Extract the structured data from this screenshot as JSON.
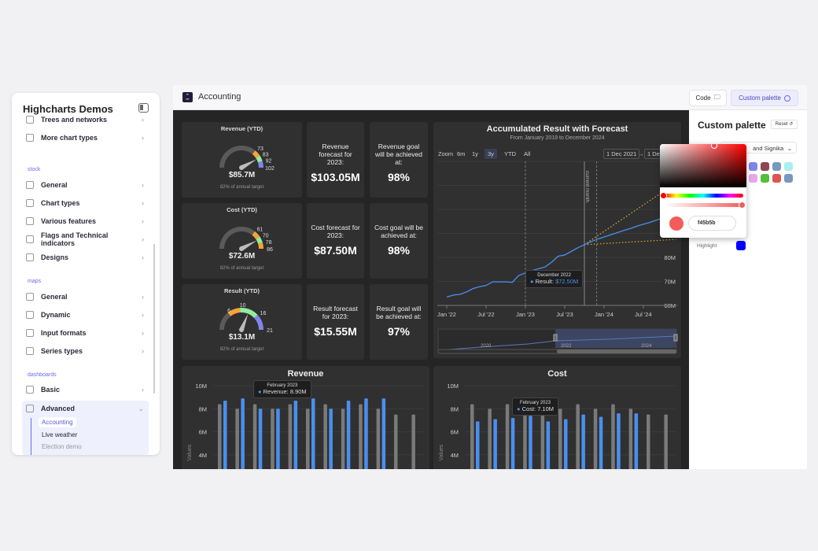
{
  "sidebar": {
    "title": "Highcharts Demos",
    "top_items": [
      {
        "label": "Trees and networks",
        "icon": "line-chart-icon"
      },
      {
        "label": "More chart types",
        "icon": "star-chart-icon"
      }
    ],
    "sections": [
      {
        "label": "stock",
        "items": [
          {
            "label": "General",
            "icon": "stock-general-icon"
          },
          {
            "label": "Chart types",
            "icon": "chart-types-icon"
          },
          {
            "label": "Various features",
            "icon": "features-icon"
          },
          {
            "label": "Flags and Technical indicators",
            "icon": "flag-icon"
          },
          {
            "label": "Designs",
            "icon": "palette-icon"
          }
        ]
      },
      {
        "label": "maps",
        "items": [
          {
            "label": "General",
            "icon": "globe-icon"
          },
          {
            "label": "Dynamic",
            "icon": "dynamic-icon"
          },
          {
            "label": "Input formats",
            "icon": "file-icon"
          },
          {
            "label": "Series types",
            "icon": "series-icon"
          }
        ]
      },
      {
        "label": "dashboards",
        "items": [
          {
            "label": "Basic",
            "icon": "dashboard-icon"
          },
          {
            "label": "Advanced",
            "icon": "dashboard-icon",
            "expanded": true
          }
        ]
      }
    ],
    "sub_items": [
      {
        "label": "Accounting",
        "active": true
      },
      {
        "label": "Live weather"
      },
      {
        "label": "Election demo"
      }
    ]
  },
  "header": {
    "title": "Accounting",
    "code_label": "Code",
    "palette_label": "Custom palette"
  },
  "gauges": [
    {
      "title": "Revenue (YTD)",
      "value_label": "$85.7M",
      "value": 85.7,
      "min": 0,
      "max": 102,
      "sub": "82% of annual target",
      "bands": [
        {
          "from": 0,
          "to": 73,
          "color": "#5a5a5a"
        },
        {
          "from": 73,
          "to": 83,
          "color": "#f7a33a"
        },
        {
          "from": 83,
          "to": 92,
          "color": "#90ed9d"
        },
        {
          "from": 92,
          "to": 102,
          "color": "#8085e9"
        }
      ],
      "ticks": [
        "73",
        "83",
        "92",
        "102"
      ]
    },
    {
      "title": "Cost (YTD)",
      "value_label": "$72.6M",
      "value": 72.6,
      "min": 0,
      "max": 86,
      "sub": "82% of annual target",
      "bands": [
        {
          "from": 0,
          "to": 61,
          "color": "#5a5a5a"
        },
        {
          "from": 61,
          "to": 70,
          "color": "#f7a33a"
        },
        {
          "from": 70,
          "to": 78,
          "color": "#90ed9d"
        },
        {
          "from": 78,
          "to": 86,
          "color": "#f7a33a"
        }
      ],
      "ticks": [
        "61",
        "70",
        "78",
        "86"
      ]
    },
    {
      "title": "Result (YTD)",
      "value_label": "$13.1M",
      "value": 13.1,
      "min": 0,
      "max": 21,
      "sub": "82% of annual target",
      "bands": [
        {
          "from": 0,
          "to": 6,
          "color": "#5a5a5a"
        },
        {
          "from": 6,
          "to": 10,
          "color": "#f7a33a"
        },
        {
          "from": 10,
          "to": 16,
          "color": "#90ed9d"
        },
        {
          "from": 16,
          "to": 21,
          "color": "#8085e9"
        }
      ],
      "ticks": [
        "6",
        "10",
        "16",
        "21"
      ]
    }
  ],
  "forecasts": [
    {
      "label": "Revenue forecast for 2023:",
      "value": "$103.05M"
    },
    {
      "label": "Cost forecast for 2023:",
      "value": "$87.50M"
    },
    {
      "label": "Result forecast for 2023:",
      "value": "$15.55M"
    }
  ],
  "goals": [
    {
      "label": "Revenue goal will be achieved at:",
      "value": "98%"
    },
    {
      "label": "Cost goal will be achieved at:",
      "value": "98%"
    },
    {
      "label": "Result goal will be achieved at:",
      "value": "97%"
    }
  ],
  "chart_data": [
    {
      "type": "line",
      "title": "Accumulated Result with Forecast",
      "subtitle": "From January 2019 to December 2024",
      "range_selector": {
        "label": "Zoom",
        "buttons": [
          "6m",
          "1y",
          "3y",
          "YTD",
          "All"
        ],
        "selected": "3y",
        "from": "1 Dec 2021",
        "arrow": "→",
        "to": "1 Dec"
      },
      "x_ticks": [
        "Jan '22",
        "Jul '22",
        "Jan '23",
        "Jul '23",
        "Jan '24",
        "Jul '24"
      ],
      "y_ticks": [
        "60M",
        "70M",
        "80M"
      ],
      "ylim": [
        60,
        120
      ],
      "plot_line_label": "current month",
      "series": [
        {
          "name": "Result",
          "color": "#4a8ff0",
          "start": "2022-01",
          "values": [
            63.5,
            64.3,
            64.6,
            65.6,
            67.0,
            67.8,
            68.3,
            69.8,
            69.8,
            69.8,
            69.6,
            72.5,
            73.5,
            74.5,
            75.3,
            76.0,
            78.0,
            80.5,
            81.0,
            82.5,
            84.0,
            85.3,
            86.5,
            87.6,
            88.5,
            89.4,
            90.3,
            91.2,
            92.0,
            93.0,
            93.8,
            94.6,
            95.5,
            96.5
          ]
        },
        {
          "type": "forecast-high",
          "color": "#e0b030",
          "from": [
            "2023-10",
            85.3
          ],
          "to": [
            "2024-12",
            111
          ]
        },
        {
          "type": "forecast-low",
          "color": "#e0b030",
          "from": [
            "2023-10",
            85.3
          ],
          "to": [
            "2024-12",
            87.5
          ]
        }
      ],
      "tooltip": {
        "date": "December 2022",
        "series": "Result",
        "value": "$72.50M"
      },
      "navigator_labels": [
        "2020",
        "2022",
        "2024"
      ]
    },
    {
      "type": "bar",
      "title": "Revenue",
      "ylabel": "Values",
      "y_ticks": [
        "10M",
        "8M",
        "6M",
        "4M"
      ],
      "series": [
        {
          "name": "",
          "color": "#7a7a7a",
          "values": [
            8.4,
            8.0,
            8.4,
            8.0,
            8.4,
            8.0,
            8.4,
            8.0,
            8.4,
            8.0,
            7.5,
            7.5
          ]
        },
        {
          "name": "Revenue",
          "color": "#4a8ff0",
          "values": [
            8.7,
            8.9,
            8.0,
            8.0,
            8.7,
            8.9,
            8.0,
            8.7,
            8.9,
            8.9,
            null,
            null
          ]
        }
      ],
      "tooltip": {
        "date": "February 2023",
        "text": "Revenue: 8.90M"
      }
    },
    {
      "type": "bar",
      "title": "Cost",
      "ylabel": "Values",
      "y_ticks": [
        "10M",
        "8M",
        "6M",
        "4M"
      ],
      "series": [
        {
          "name": "",
          "color": "#7a7a7a",
          "values": [
            8.4,
            8.0,
            8.4,
            8.0,
            8.0,
            8.0,
            8.4,
            8.0,
            8.4,
            8.0,
            7.5,
            7.5
          ]
        },
        {
          "name": "Cost",
          "color": "#4a8ff0",
          "values": [
            6.9,
            7.1,
            7.2,
            7.4,
            6.9,
            7.1,
            7.5,
            7.3,
            7.6,
            7.6,
            null,
            null
          ]
        }
      ],
      "tooltip": {
        "date": "February 2023",
        "text": "Cost: 7.10M"
      }
    }
  ],
  "palette_panel": {
    "title": "Custom palette",
    "reset_label": "Reset",
    "font_select": "and Signika",
    "swatches": [
      "#8085e9",
      "#8d4654",
      "#7798bf",
      "#aaeeee",
      "#e8a8e8",
      "#55bf3b",
      "#df5353",
      "#7798bf"
    ],
    "highlight_label": "Highlight",
    "highlight_color": "#0000ff"
  },
  "color_picker": {
    "hex": "f45b5b",
    "color": "#f45b5b"
  }
}
